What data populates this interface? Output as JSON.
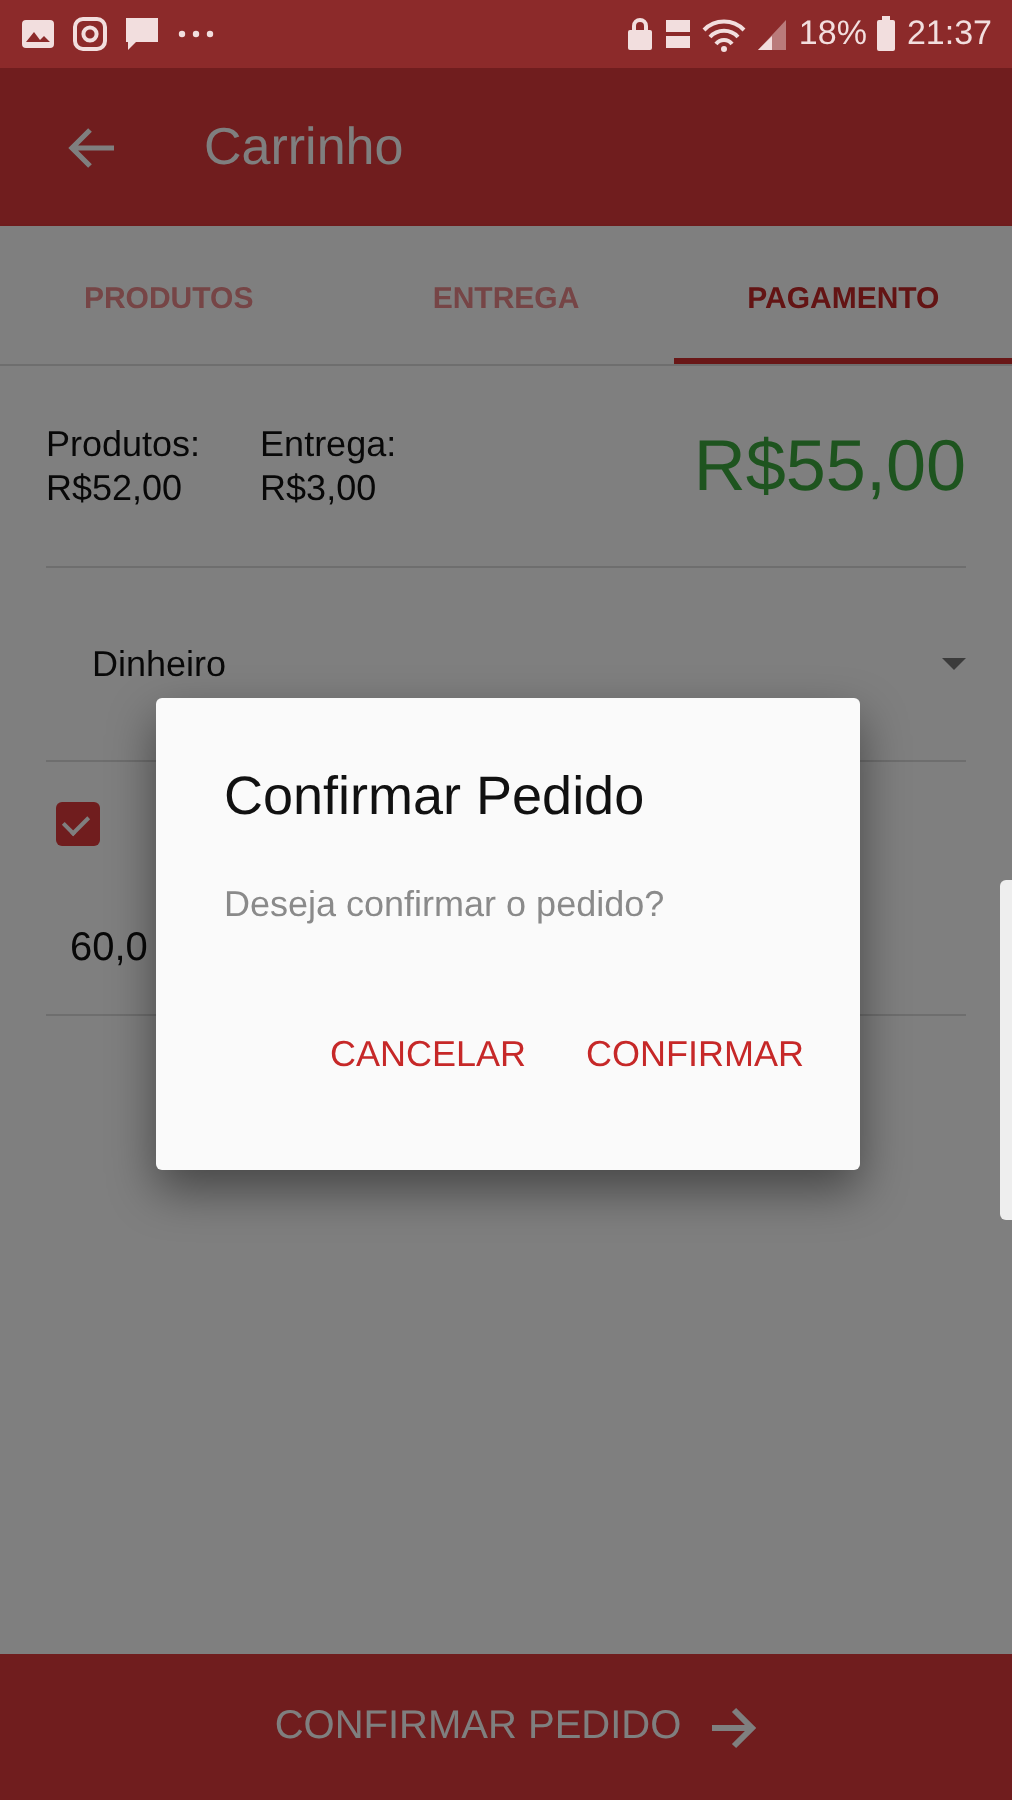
{
  "status_bar": {
    "battery": "18%",
    "time": "21:37"
  },
  "app_bar": {
    "title": "Carrinho"
  },
  "tabs": [
    {
      "label": "PRODUTOS",
      "selected": false
    },
    {
      "label": "ENTREGA",
      "selected": false
    },
    {
      "label": "PAGAMENTO",
      "selected": true
    }
  ],
  "summary": {
    "products_label": "Produtos:",
    "products_value": "R$52,00",
    "delivery_label": "Entrega:",
    "delivery_value": "R$3,00",
    "total": "R$55,00"
  },
  "payment": {
    "method": "Dinheiro"
  },
  "change": {
    "checked": true,
    "amount": "60,0"
  },
  "bottom_button": {
    "label": "CONFIRMAR PEDIDO"
  },
  "dialog": {
    "title": "Confirmar Pedido",
    "message": "Deseja confirmar o pedido?",
    "buttons": [
      "CANCELAR",
      "CONFIRMAR"
    ]
  }
}
